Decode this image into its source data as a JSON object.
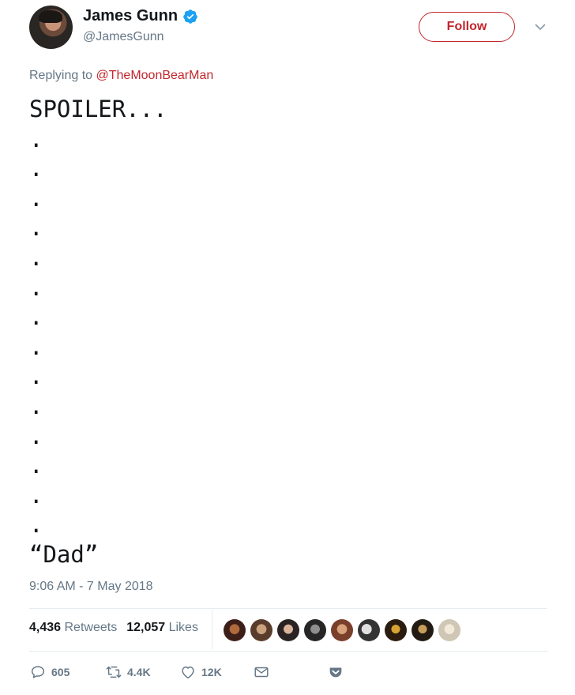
{
  "profile": {
    "name": "James Gunn",
    "handle": "@JamesGunn",
    "follow_label": "Follow"
  },
  "tweet": {
    "reply_prefix": "Replying to",
    "reply_to": "@TheMoonBearMan",
    "text": "SPOILER...\n.\n.\n.\n.\n.\n.\n.\n.\n.\n.\n.\n.\n.\n.\n“Dad”",
    "timestamp": "9:06 AM - 7 May 2018"
  },
  "stats": {
    "retweets_count": "4,436",
    "retweets_label": "Retweets",
    "likes_count": "12,057",
    "likes_label": "Likes"
  },
  "actions": {
    "replies": "605",
    "retweets": "4.4K",
    "likes": "12K"
  },
  "colors": {
    "accent": "#c1272d",
    "verified": "#1da1f2",
    "muted": "#657786"
  },
  "icons": [
    "verified-badge-icon",
    "chevron-down-icon",
    "reply-icon",
    "retweet-icon",
    "heart-icon",
    "envelope-icon",
    "pocket-icon"
  ]
}
